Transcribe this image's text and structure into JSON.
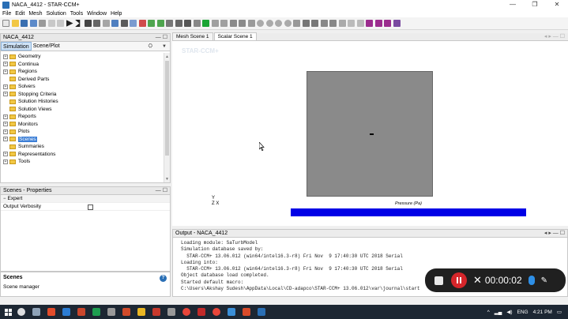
{
  "window": {
    "title": "NACA_4412 - STAR-CCM+",
    "controls": [
      "—",
      "❐",
      "✕"
    ]
  },
  "menu": [
    "File",
    "Edit",
    "Mesh",
    "Solution",
    "Tools",
    "Window",
    "Help"
  ],
  "tree_panel": {
    "header": "NACA_4412",
    "controls": "— ☐",
    "tabs": [
      "Simulation",
      "Scene/Plot"
    ],
    "items": [
      {
        "label": "Geometry",
        "expandable": true
      },
      {
        "label": "Continua",
        "expandable": true
      },
      {
        "label": "Regions",
        "expandable": true
      },
      {
        "label": "Derived Parts",
        "expandable": false
      },
      {
        "label": "Solvers",
        "expandable": true
      },
      {
        "label": "Stopping Criteria",
        "expandable": true
      },
      {
        "label": "Solution Histories",
        "expandable": false
      },
      {
        "label": "Solution Views",
        "expandable": false
      },
      {
        "label": "Reports",
        "expandable": true
      },
      {
        "label": "Monitors",
        "expandable": true
      },
      {
        "label": "Plots",
        "expandable": true
      },
      {
        "label": "Scenes",
        "expandable": true,
        "selected": true
      },
      {
        "label": "Summaries",
        "expandable": false
      },
      {
        "label": "Representations",
        "expandable": true
      },
      {
        "label": "Tools",
        "expandable": true
      }
    ]
  },
  "props_panel": {
    "header": "Scenes - Properties",
    "controls": "— ☐",
    "section": "Expert",
    "property": "Output Verbosity"
  },
  "help_panel": {
    "title": "Scenes",
    "description": "Scene manager",
    "icon": "?"
  },
  "scene": {
    "tabs": [
      "Mesh Scene 1",
      "Scalar Scene 1"
    ],
    "active_tab": 1,
    "nav": "◂ ▸ — ☐",
    "watermark": "STAR-CCM+",
    "axis_y": "Y",
    "axis_zx": "Z  X",
    "legend_title": "Pressure (Pa)",
    "domain_color": "#8a8a8a",
    "legend_color": "#0000e6"
  },
  "output": {
    "header": "Output - NACA_4412",
    "controls": "◂ ▸ — ☐",
    "lines": [
      "Loading module: SaTurbModel",
      "Simulation database saved by:",
      "  STAR-CCM+ 13.06.012 (win64/intel16.3-r8) Fri Nov  9 17:40:30 UTC 2018 Serial",
      "Loading into:",
      "  STAR-CCM+ 13.06.012 (win64/intel16.3-r8) Fri Nov  9 17:40:30 UTC 2018 Serial",
      "Object database load completed.",
      "Started default macro:",
      "C:\\Users\\Akshay Sudesh\\AppData\\Local\\CD-adapco\\STAR-CCM+ 13.06.012\\var\\journal\\start"
    ]
  },
  "recorder": {
    "time": "00:00:02"
  },
  "taskbar": {
    "lang": "ENG",
    "time": "4:21 PM"
  }
}
